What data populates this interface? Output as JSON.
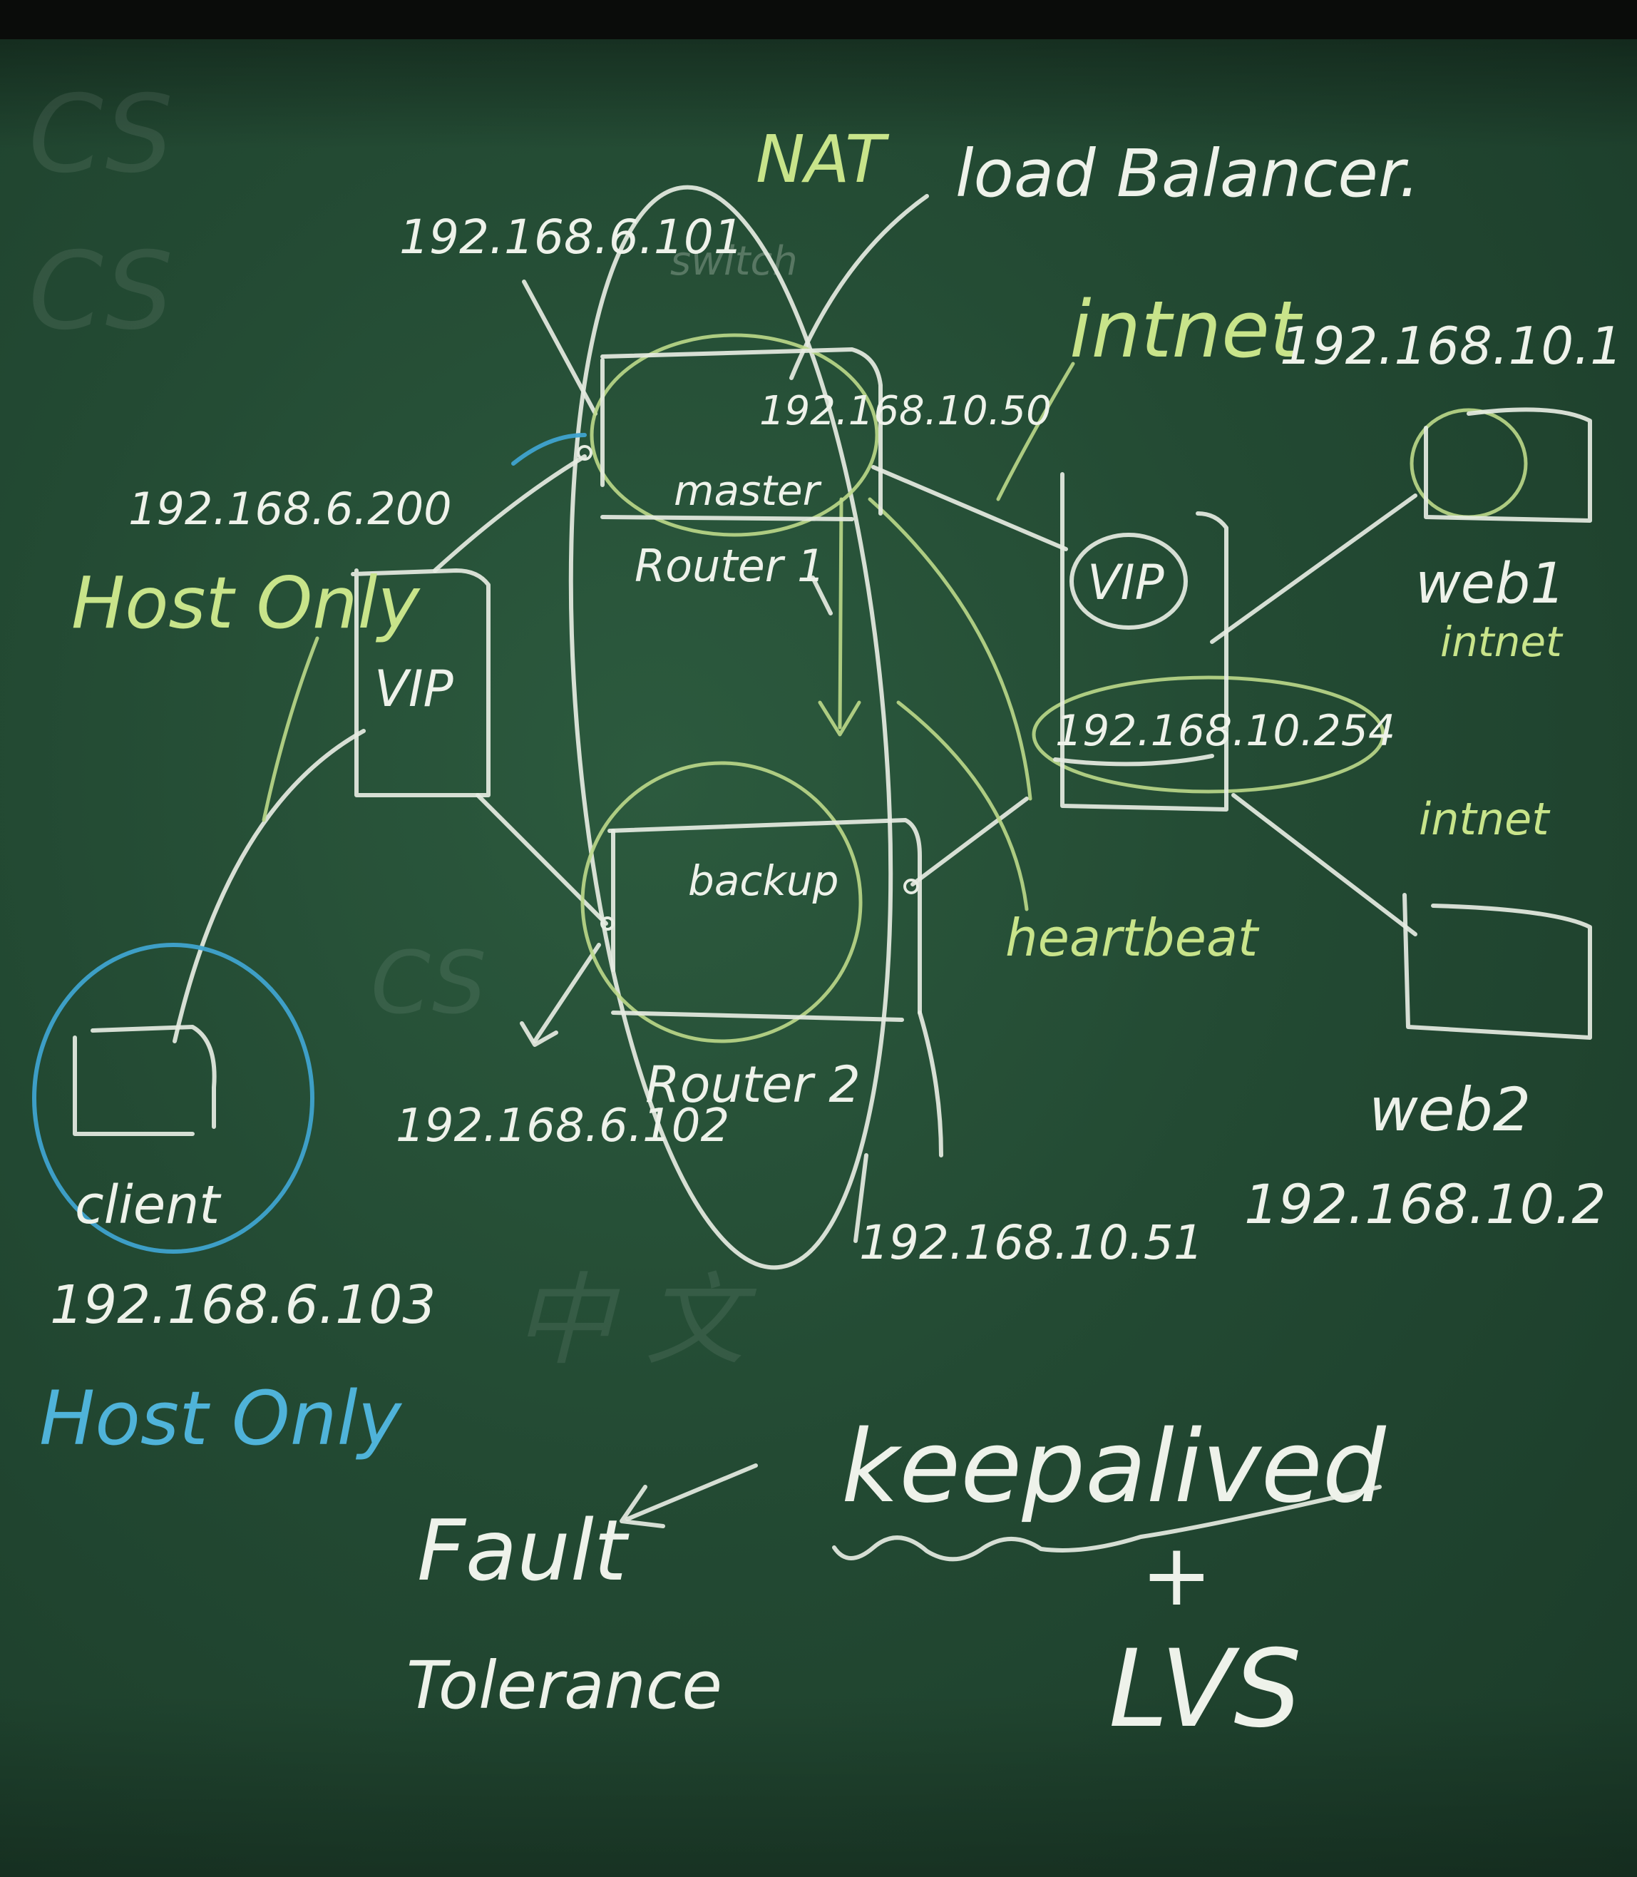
{
  "colors": {
    "board": "#234a33",
    "chalk_white": "#eef2ea",
    "chalk_green": "#c8e48a",
    "chalk_blue": "#4fb3d9"
  },
  "title": {
    "nat": "NAT",
    "rest": "load Balancer."
  },
  "router1": {
    "ip_left": "192.168.6.101",
    "vip_ip": "192.168.6.200",
    "ip_right": "192.168.10.50",
    "role": "master",
    "name": "Router 1"
  },
  "router2": {
    "ip_left": "192.168.6.102",
    "ip_right": "192.168.10.51",
    "role": "backup",
    "name": "Router 2"
  },
  "vip_left": {
    "label": "VIP"
  },
  "vip_right": {
    "label": "VIP",
    "ip": "192.168.10.254"
  },
  "switch_label": "switch",
  "networks": {
    "host_only": "Host Only",
    "intnet": "intnet",
    "intnet_web1": "intnet",
    "intnet_web2": "intnet",
    "heartbeat": "heartbeat"
  },
  "web1": {
    "name": "web1",
    "ip": "192.168.10.1"
  },
  "web2": {
    "name": "web2",
    "ip": "192.168.10.2"
  },
  "client": {
    "name": "client",
    "ip": "192.168.6.103",
    "network": "Host Only"
  },
  "bottom": {
    "fault": "Fault",
    "tolerance": "Tolerance",
    "keepalived": "keepalived",
    "plus": "+",
    "lvs": "LVS"
  }
}
